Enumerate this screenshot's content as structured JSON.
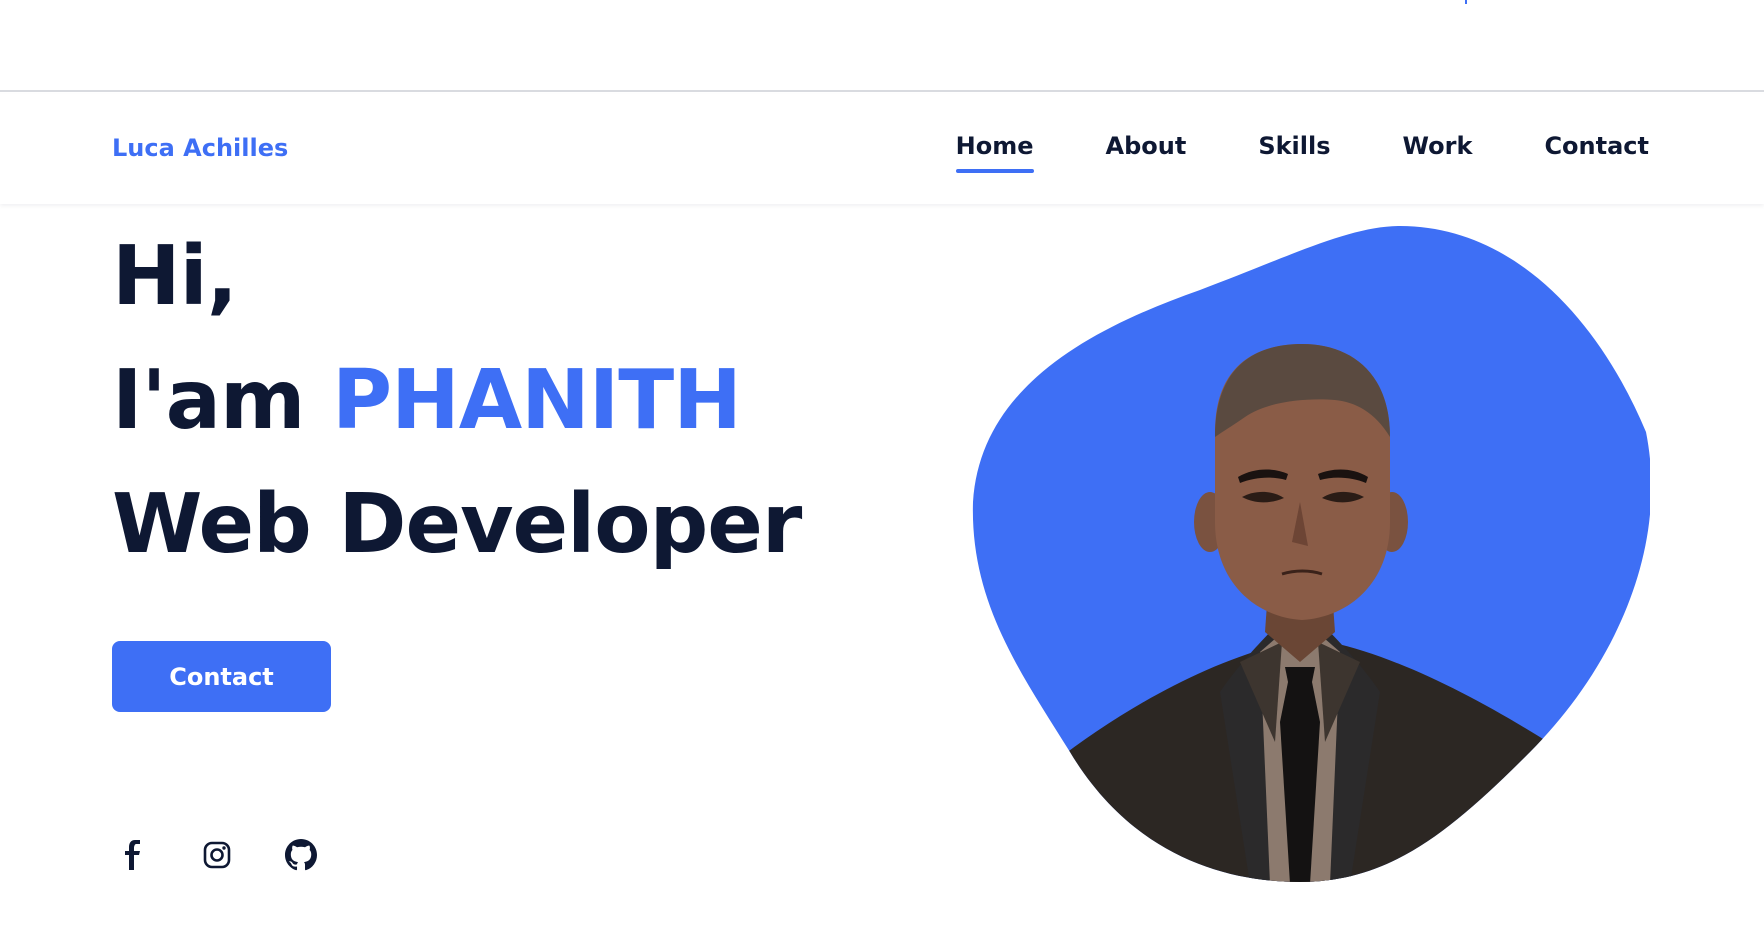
{
  "header": {
    "brand": "Luca Achilles",
    "nav": [
      {
        "label": "Home",
        "active": true
      },
      {
        "label": "About",
        "active": false
      },
      {
        "label": "Skills",
        "active": false
      },
      {
        "label": "Work",
        "active": false
      },
      {
        "label": "Contact",
        "active": false
      }
    ]
  },
  "hero": {
    "greeting": "Hi,",
    "intro": "I'am",
    "name": "PHANITH",
    "role": "Web Developer",
    "cta_label": "Contact"
  },
  "socials": [
    {
      "icon": "facebook-icon"
    },
    {
      "icon": "instagram-icon"
    },
    {
      "icon": "github-icon"
    }
  ],
  "colors": {
    "accent": "#3e6ff5",
    "text": "#0e1833",
    "background": "#ffffff"
  }
}
